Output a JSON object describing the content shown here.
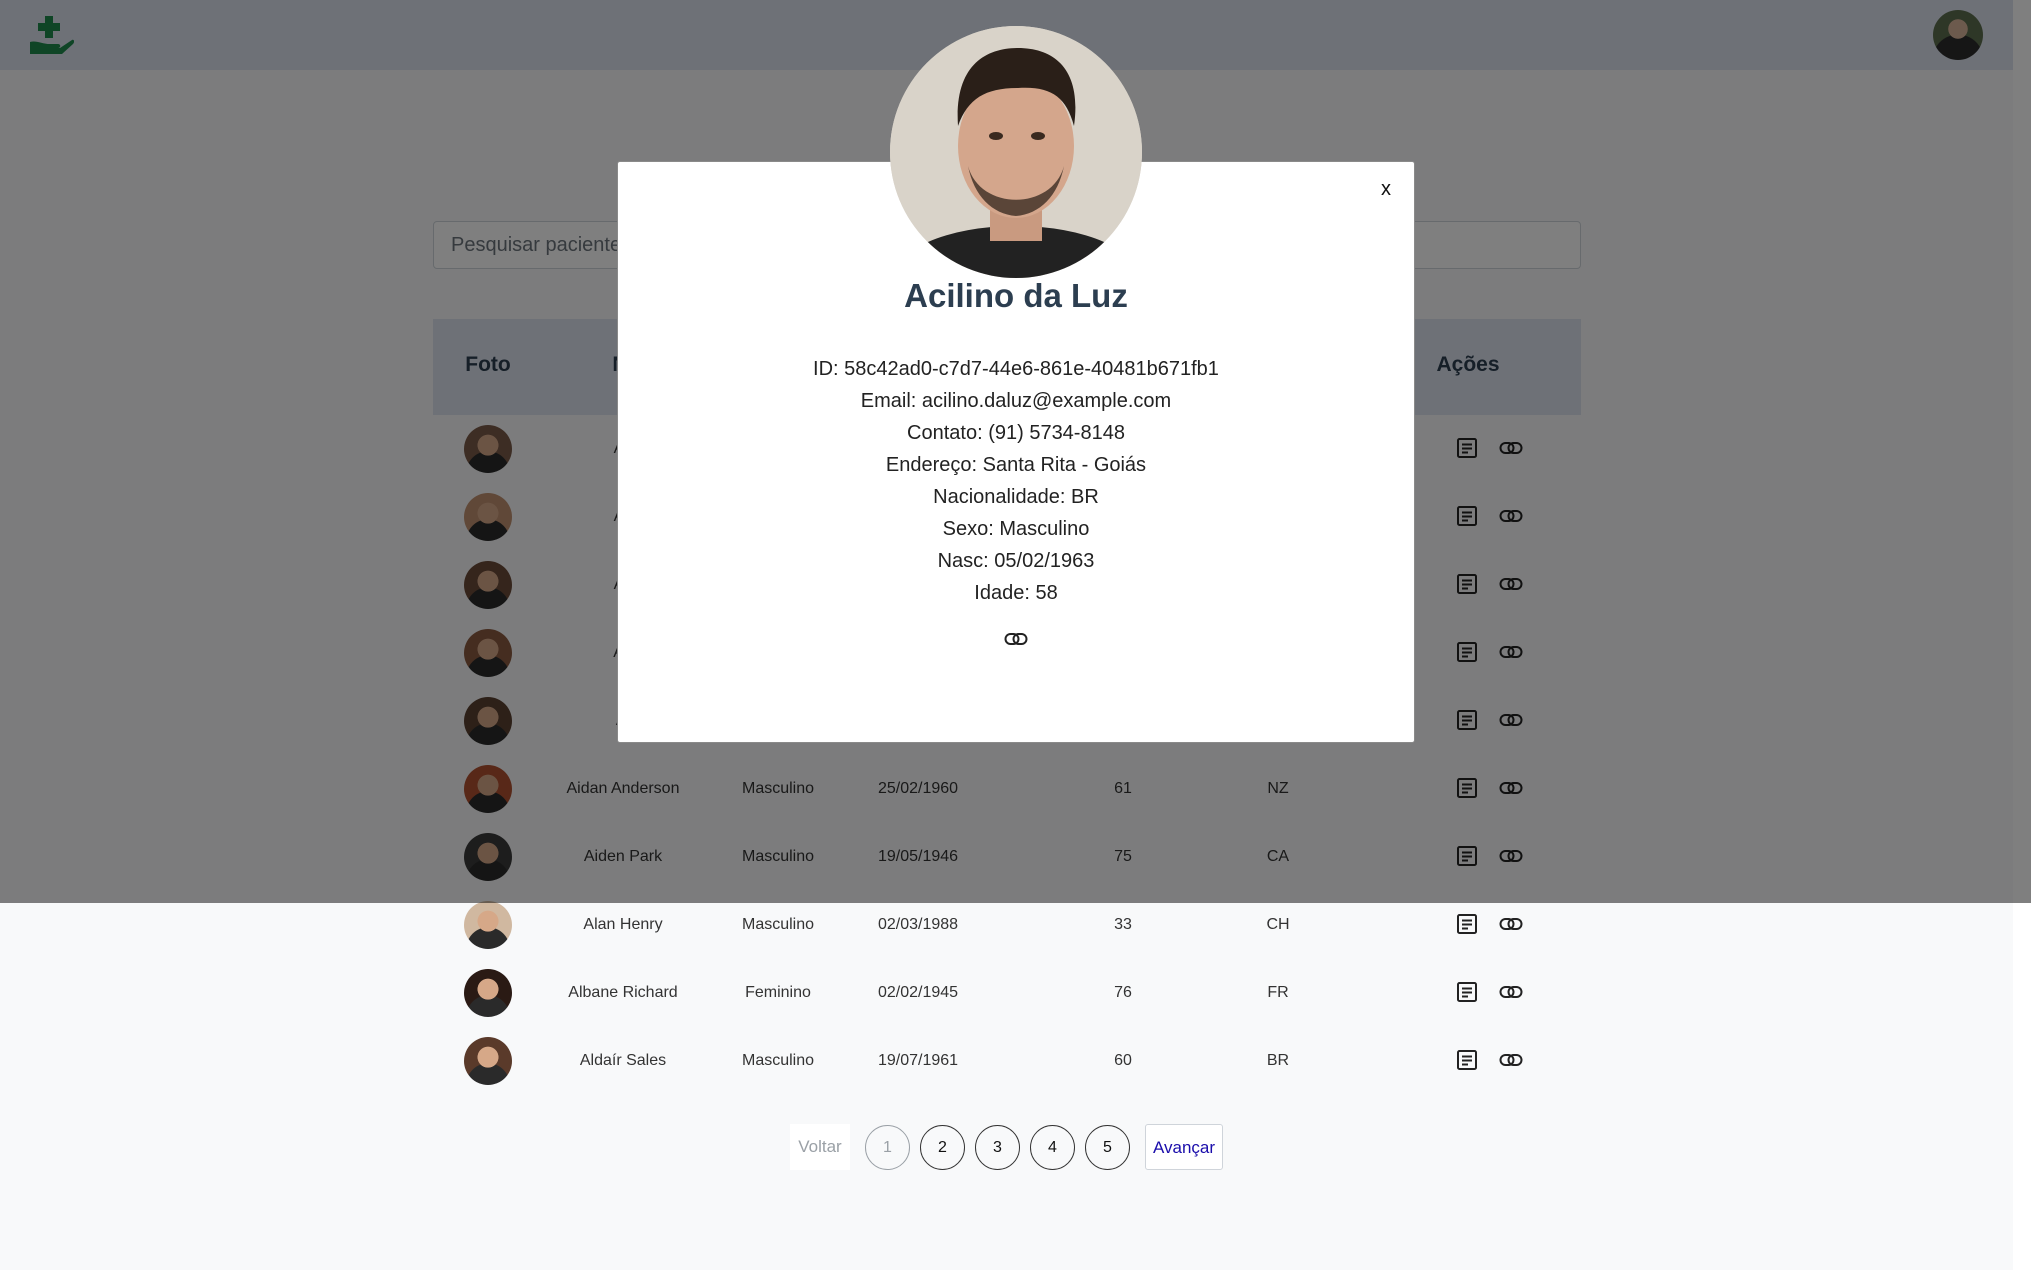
{
  "app": {
    "brand_icon": "hand-medical-icon",
    "brand_color": "#1f8a4c",
    "user_avatar": "user-avatar"
  },
  "search": {
    "placeholder": "Pesquisar paciente"
  },
  "table": {
    "headers": {
      "foto": "Foto",
      "nome": "N",
      "acoes": "Ações"
    },
    "rows": [
      {
        "name": "Ac",
        "gender": "",
        "birth": "",
        "age": "",
        "nat": ""
      },
      {
        "name": "Ac",
        "gender": "",
        "birth": "",
        "age": "",
        "nat": ""
      },
      {
        "name": "Ac",
        "gender": "",
        "birth": "",
        "age": "",
        "nat": ""
      },
      {
        "name": "Ag",
        "gender": "",
        "birth": "",
        "age": "",
        "nat": ""
      },
      {
        "name": "Ai",
        "gender": "",
        "birth": "",
        "age": "",
        "nat": ""
      },
      {
        "name": "Aidan Anderson",
        "gender": "Masculino",
        "birth": "25/02/1960",
        "age": "61",
        "nat": "NZ"
      },
      {
        "name": "Aiden Park",
        "gender": "Masculino",
        "birth": "19/05/1946",
        "age": "75",
        "nat": "CA"
      },
      {
        "name": "Alan Henry",
        "gender": "Masculino",
        "birth": "02/03/1988",
        "age": "33",
        "nat": "CH"
      },
      {
        "name": "Albane Richard",
        "gender": "Feminino",
        "birth": "02/02/1945",
        "age": "76",
        "nat": "FR"
      },
      {
        "name": "Aldaír Sales",
        "gender": "Masculino",
        "birth": "19/07/1961",
        "age": "60",
        "nat": "BR"
      }
    ],
    "action_icons": [
      "details-icon",
      "link-icon"
    ]
  },
  "pagination": {
    "prev": "Voltar",
    "next": "Avançar",
    "pages": [
      "1",
      "2",
      "3",
      "4",
      "5"
    ],
    "current": "1"
  },
  "modal": {
    "close": "x",
    "name": "Acilino da Luz",
    "info": [
      "ID: 58c42ad0-c7d7-44e6-861e-40481b671fb1",
      "Email: acilino.daluz@example.com",
      "Contato: (91) 5734-8148",
      "Endereço: Santa Rita - Goiás",
      "Nacionalidade: BR",
      "Sexo: Masculino",
      "Nasc: 05/02/1963",
      "Idade: 58"
    ],
    "link_icon": "link-icon"
  }
}
